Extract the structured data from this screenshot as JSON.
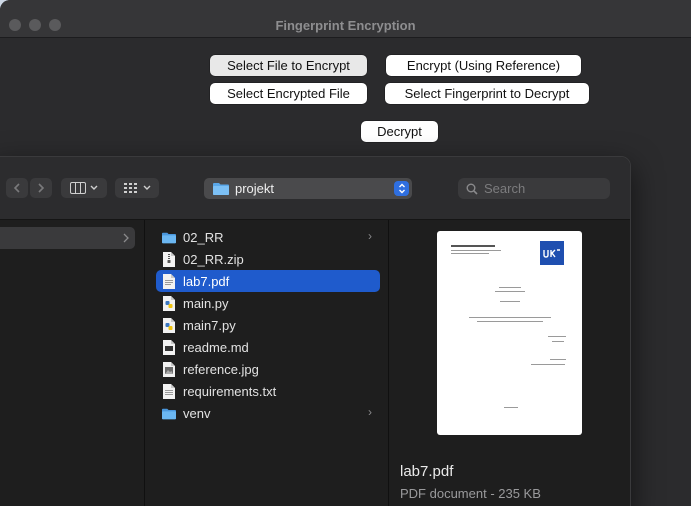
{
  "window": {
    "title": "Fingerprint Encryption"
  },
  "app_buttons": {
    "select_file_to_encrypt": "Select File to Encrypt",
    "encrypt_using_reference": "Encrypt (Using Reference)",
    "select_encrypted_file": "Select Encrypted File",
    "select_fingerprint_to_decrypt": "Select Fingerprint to Decrypt",
    "decrypt": "Decrypt"
  },
  "dialog": {
    "location": "projekt",
    "search_placeholder": "Search",
    "files": [
      {
        "name": "02_RR",
        "icon": "folder-icon",
        "has_children": true
      },
      {
        "name": "02_RR.zip",
        "icon": "zip-file-icon",
        "has_children": false
      },
      {
        "name": "lab7.pdf",
        "icon": "pdf-file-icon",
        "has_children": false,
        "selected": true
      },
      {
        "name": "main.py",
        "icon": "python-file-icon",
        "has_children": false
      },
      {
        "name": "main7.py",
        "icon": "python-file-icon",
        "has_children": false
      },
      {
        "name": "readme.md",
        "icon": "markdown-file-icon",
        "has_children": false
      },
      {
        "name": "reference.jpg",
        "icon": "image-file-icon",
        "has_children": false
      },
      {
        "name": "requirements.txt",
        "icon": "text-file-icon",
        "has_children": false
      },
      {
        "name": "venv",
        "icon": "folder-icon",
        "has_children": true
      }
    ],
    "preview": {
      "file_name": "lab7.pdf",
      "kind_and_size": "PDF document - 235 KB"
    }
  },
  "colors": {
    "selection": "#1f5bcc",
    "folder": "#5aa7e8",
    "window_bg": "#2b2b2d"
  }
}
